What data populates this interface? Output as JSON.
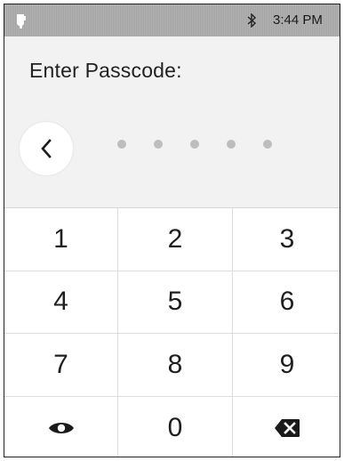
{
  "status_bar": {
    "left_icon": "mug-icon",
    "bluetooth_icon": "bluetooth-icon",
    "time": "3:44 PM"
  },
  "prompt": {
    "title": "Enter Passcode:",
    "back_icon": "chevron-left-icon",
    "entered_digits": 5
  },
  "keypad": {
    "keys": [
      "1",
      "2",
      "3",
      "4",
      "5",
      "6",
      "7",
      "8",
      "9",
      "",
      "0",
      ""
    ],
    "show_icon": "eye-icon",
    "delete_icon": "backspace-icon"
  }
}
